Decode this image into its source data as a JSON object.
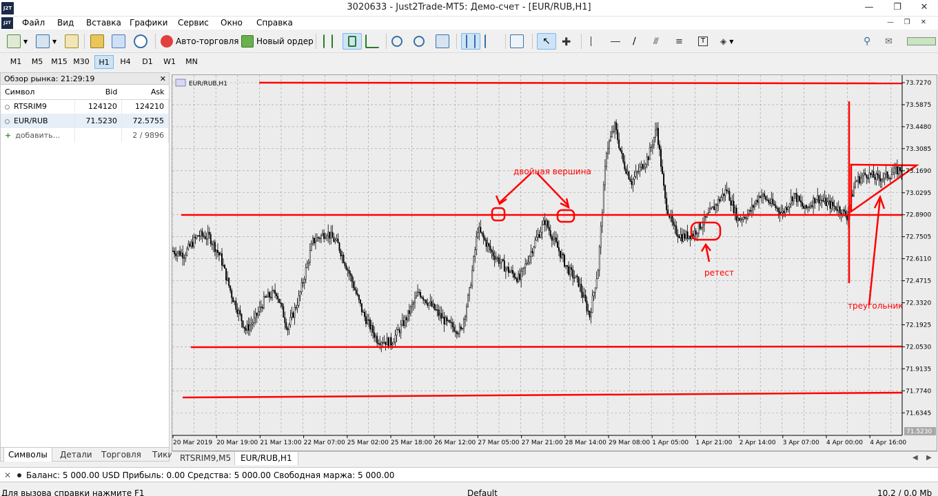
{
  "window": {
    "title": "3020633 - Just2Trade-MT5: Демо-счет - [EUR/RUB,H1]",
    "logo": "J2T"
  },
  "menu": [
    "Файл",
    "Вид",
    "Вставка",
    "Графики",
    "Сервис",
    "Окно",
    "Справка"
  ],
  "toolbar": {
    "autotrading_label": "Авто-торговля",
    "new_order_label": "Новый ордер"
  },
  "timeframes": [
    "M1",
    "M5",
    "M15",
    "M30",
    "H1",
    "H4",
    "D1",
    "W1",
    "MN"
  ],
  "active_timeframe": "H1",
  "market_watch": {
    "title": "Обзор рынка: 21:29:19",
    "columns": [
      "Символ",
      "Bid",
      "Ask"
    ],
    "rows": [
      {
        "symbol": "RTSRIM9",
        "bid": "124120",
        "ask": "124210"
      },
      {
        "symbol": "EUR/RUB",
        "bid": "71.5230",
        "ask": "72.5755"
      }
    ],
    "add_label": "добавить...",
    "count": "2 / 9896",
    "tabs": [
      "Символы",
      "Детали",
      "Торговля",
      "Тики"
    ]
  },
  "chart": {
    "label": "EUR/RUB,H1",
    "price_labels": [
      "73.7270",
      "73.5875",
      "73.4480",
      "73.3085",
      "73.1690",
      "73.0295",
      "72.8900",
      "72.7505",
      "72.6110",
      "72.4715",
      "72.3320",
      "72.1925",
      "72.0530",
      "71.9135",
      "71.7740",
      "71.6345"
    ],
    "current_price": "71.5230",
    "time_labels": [
      "20 Mar 2019",
      "20 Mar 19:00",
      "21 Mar 13:00",
      "22 Mar 07:00",
      "25 Mar 02:00",
      "25 Mar 18:00",
      "26 Mar 12:00",
      "27 Mar 05:00",
      "27 Mar 21:00",
      "28 Mar 14:00",
      "29 Mar 08:00",
      "1 Apr 05:00",
      "1 Apr 21:00",
      "2 Apr 14:00",
      "3 Apr 07:00",
      "4 Apr 00:00",
      "4 Apr 16:00"
    ],
    "annotations": {
      "double_top": "двойная вершина",
      "retest": "ретест",
      "triangle": "треугольник"
    },
    "colors": {
      "bull": "#000000",
      "bear": "#000000",
      "annotation": "#ff0000"
    }
  },
  "chart_tabs": [
    "RTSRIM9,M5",
    "EUR/RUB,H1"
  ],
  "active_chart_tab": "EUR/RUB,H1",
  "balance": "Баланс: 5 000.00 USD  Прибыль: 0.00  Средства: 5 000.00  Свободная маржа: 5 000.00",
  "status": {
    "help": "Для вызова справки нажмите F1",
    "profile": "Default",
    "traffic": "10.2 / 0.0 Mb"
  }
}
